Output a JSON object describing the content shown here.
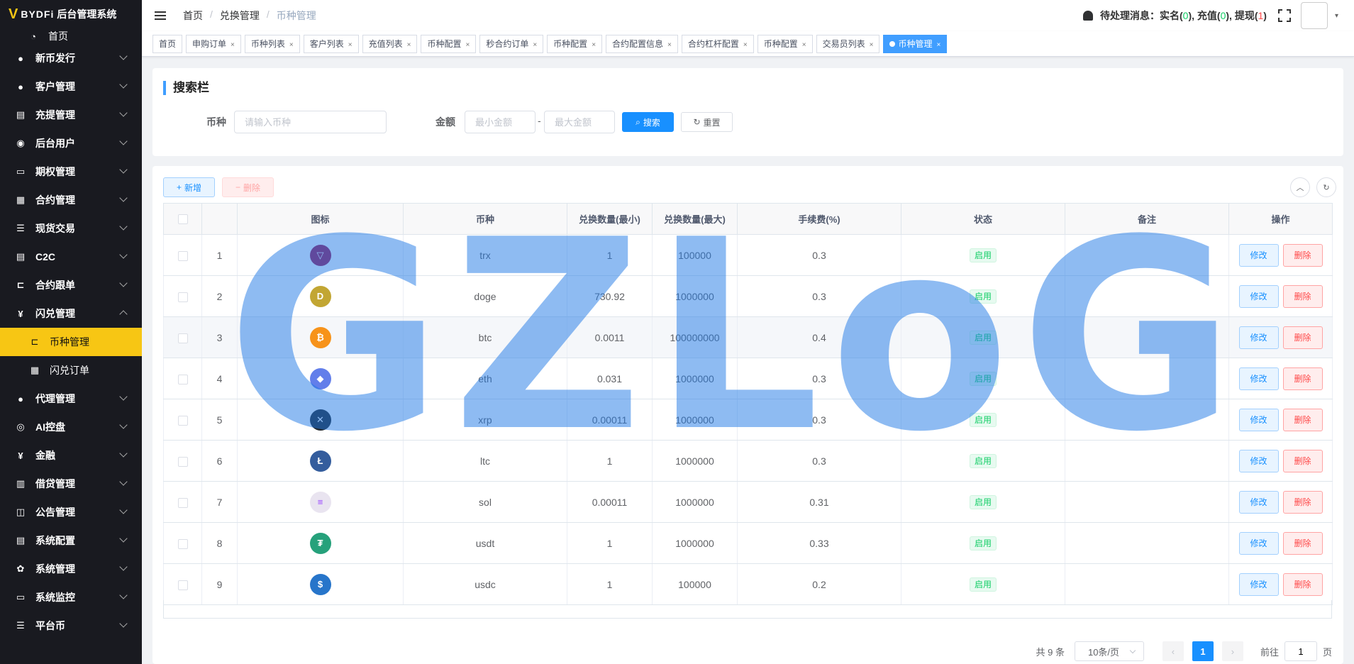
{
  "app": {
    "brand": "BYDFi",
    "title": "后台管理系统"
  },
  "sidebar": {
    "home": "首页",
    "items": [
      {
        "label": "新币发行",
        "icon": "user-icon",
        "expanded": false
      },
      {
        "label": "客户管理",
        "icon": "user-icon",
        "expanded": false
      },
      {
        "label": "充提管理",
        "icon": "document-icon",
        "expanded": false
      },
      {
        "label": "后台用户",
        "icon": "user-group-icon",
        "expanded": false
      },
      {
        "label": "期权管理",
        "icon": "monitor-icon",
        "expanded": false
      },
      {
        "label": "合约管理",
        "icon": "grid-icon",
        "expanded": false
      },
      {
        "label": "现货交易",
        "icon": "list-icon",
        "expanded": false
      },
      {
        "label": "C2C",
        "icon": "document-icon",
        "expanded": false
      },
      {
        "label": "合约跟单",
        "icon": "tree-icon",
        "expanded": false
      },
      {
        "label": "闪兑管理",
        "icon": "yen-icon",
        "expanded": true
      },
      {
        "label": "币种管理",
        "icon": "tree-icon",
        "sub": true,
        "active": true
      },
      {
        "label": "闪兑订单",
        "icon": "grid-icon",
        "sub": true
      },
      {
        "label": "代理管理",
        "icon": "user-icon",
        "expanded": false
      },
      {
        "label": "AI控盘",
        "icon": "robot-icon",
        "expanded": false
      },
      {
        "label": "金融",
        "icon": "yen-icon",
        "expanded": false
      },
      {
        "label": "借贷管理",
        "icon": "book-icon",
        "expanded": false
      },
      {
        "label": "公告管理",
        "icon": "open-book-icon",
        "expanded": false
      },
      {
        "label": "系统配置",
        "icon": "document-icon",
        "expanded": false
      },
      {
        "label": "系统管理",
        "icon": "gear-icon",
        "expanded": false
      },
      {
        "label": "系统监控",
        "icon": "monitor-icon",
        "expanded": false
      },
      {
        "label": "平台币",
        "icon": "list-icon",
        "expanded": false
      }
    ]
  },
  "header": {
    "breadcrumb": [
      "首页",
      "兑换管理",
      "币种管理"
    ],
    "pending_label": "待处理消息：",
    "realname_label": "实名",
    "realname_count": "0",
    "deposit_label": "充值",
    "deposit_count": "0",
    "withdraw_label": "提现",
    "withdraw_count": "1"
  },
  "tags": [
    {
      "label": "首页",
      "closable": false
    },
    {
      "label": "申购订单",
      "closable": true
    },
    {
      "label": "币种列表",
      "closable": true
    },
    {
      "label": "客户列表",
      "closable": true
    },
    {
      "label": "充值列表",
      "closable": true
    },
    {
      "label": "币种配置",
      "closable": true
    },
    {
      "label": "秒合约订单",
      "closable": true
    },
    {
      "label": "币种配置",
      "closable": true
    },
    {
      "label": "合约配置信息",
      "closable": true
    },
    {
      "label": "合约杠杆配置",
      "closable": true
    },
    {
      "label": "币种配置",
      "closable": true
    },
    {
      "label": "交易员列表",
      "closable": true
    },
    {
      "label": "币种管理",
      "closable": true,
      "active": true
    }
  ],
  "search": {
    "title": "搜索栏",
    "coin_label": "币种",
    "coin_placeholder": "请输入币种",
    "amount_label": "金额",
    "min_placeholder": "最小金额",
    "max_placeholder": "最大金额",
    "range_sep": "-",
    "search_button": "搜索",
    "reset_button": "重置"
  },
  "toolbar": {
    "add_label": "新增",
    "delete_label": "删除"
  },
  "table": {
    "columns": [
      "图标",
      "币种",
      "兑换数量(最小)",
      "兑换数量(最大)",
      "手续费(%)",
      "状态",
      "备注",
      "操作"
    ],
    "edit_label": "修改",
    "delete_label": "删除",
    "rows": [
      {
        "index": "1",
        "coin": "trx",
        "min": "1",
        "max": "100000",
        "fee": "0.3",
        "status": "启用",
        "remark": "",
        "icon_color": "#a31b54",
        "icon_glyph": "▽"
      },
      {
        "index": "2",
        "coin": "doge",
        "min": "730.92",
        "max": "1000000",
        "fee": "0.3",
        "status": "启用",
        "remark": "",
        "icon_color": "#c2a633",
        "icon_glyph": "D"
      },
      {
        "index": "3",
        "coin": "btc",
        "min": "0.0011",
        "max": "100000000",
        "fee": "0.4",
        "status": "启用",
        "remark": "",
        "icon_color": "#f7931a",
        "icon_glyph": "₿"
      },
      {
        "index": "4",
        "coin": "eth",
        "min": "0.031",
        "max": "1000000",
        "fee": "0.3",
        "status": "启用",
        "remark": "",
        "icon_color": "#627eea",
        "icon_glyph": "◆"
      },
      {
        "index": "5",
        "coin": "xrp",
        "min": "0.00011",
        "max": "1000000",
        "fee": "0.3",
        "status": "启用",
        "remark": "",
        "icon_color": "#23292f",
        "icon_glyph": "✕"
      },
      {
        "index": "6",
        "coin": "ltc",
        "min": "1",
        "max": "1000000",
        "fee": "0.3",
        "status": "启用",
        "remark": "",
        "icon_color": "#345d9d",
        "icon_glyph": "Ł"
      },
      {
        "index": "7",
        "coin": "sol",
        "min": "0.00011",
        "max": "1000000",
        "fee": "0.31",
        "status": "启用",
        "remark": "",
        "icon_color": "#e9e4f0",
        "icon_glyph": "≡"
      },
      {
        "index": "8",
        "coin": "usdt",
        "min": "1",
        "max": "1000000",
        "fee": "0.33",
        "status": "启用",
        "remark": "",
        "icon_color": "#26a17b",
        "icon_glyph": "₮"
      },
      {
        "index": "9",
        "coin": "usdc",
        "min": "1",
        "max": "100000",
        "fee": "0.2",
        "status": "启用",
        "remark": "",
        "icon_color": "#2775ca",
        "icon_glyph": "$"
      }
    ]
  },
  "pagination": {
    "total_text": "共 9 条",
    "page_size": "10条/页",
    "current_page": "1",
    "goto_label": "前往",
    "goto_value": "1",
    "page_unit": "页"
  },
  "watermark": "GZLoG"
}
